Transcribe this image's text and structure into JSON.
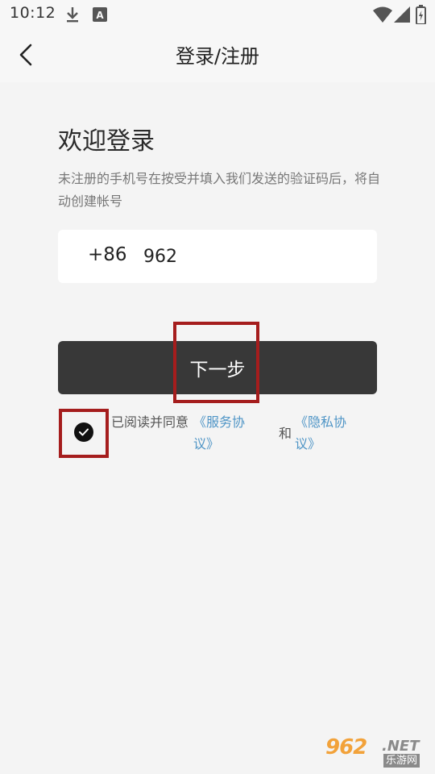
{
  "status_bar": {
    "time": "10:12",
    "icons": [
      "download-icon",
      "keyboard-a-icon",
      "wifi-icon",
      "signal-icon",
      "battery-icon"
    ]
  },
  "header": {
    "title": "登录/注册"
  },
  "login": {
    "welcome": "欢迎登录",
    "hint": "未注册的手机号在按受并填入我们发送的验证码后，将自动创建帐号",
    "country_code": "+86",
    "phone_value": "962",
    "next_label": "下一步"
  },
  "agreement": {
    "checked": true,
    "prefix": "已阅读并同意",
    "service_link": "《服务协议》",
    "and": "和",
    "privacy_link": "《隐私协议》"
  },
  "watermark": {
    "brand_number": "962",
    "brand_net": ".NET",
    "brand_sub": "乐游网"
  },
  "colors": {
    "background": "#f4f4f4",
    "button": "#383838",
    "link": "#4f95c6",
    "highlight": "#a51d1d"
  }
}
